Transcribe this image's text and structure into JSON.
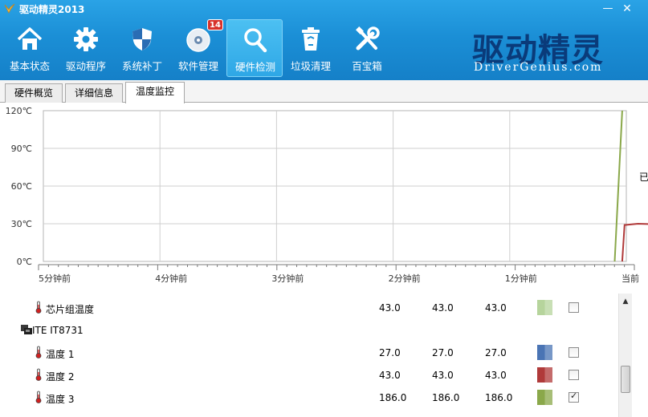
{
  "app": {
    "title": "驱动精灵2013",
    "min": "—",
    "close": "✕"
  },
  "toolbar": {
    "items": [
      {
        "label": "基本状态",
        "icon": "home-icon"
      },
      {
        "label": "驱动程序",
        "icon": "gear-icon"
      },
      {
        "label": "系统补丁",
        "icon": "shield-icon"
      },
      {
        "label": "软件管理",
        "icon": "disc-icon"
      },
      {
        "label": "硬件检测",
        "icon": "magnifier-icon"
      },
      {
        "label": "垃圾清理",
        "icon": "recycle-bin-icon"
      },
      {
        "label": "百宝箱",
        "icon": "tools-icon"
      }
    ],
    "active_index": 4,
    "badge": "14"
  },
  "brand": {
    "cn": "驱动精灵",
    "en": "DriverGenius.com"
  },
  "tabs": [
    {
      "label": "硬件概览"
    },
    {
      "label": "详细信息"
    },
    {
      "label": "温度监控"
    }
  ],
  "active_tab": 2,
  "chart_data": {
    "type": "line",
    "yticks": [
      "120℃",
      "90℃",
      "60℃",
      "30℃",
      "0℃"
    ],
    "ylim": [
      0,
      120
    ],
    "xticks": [
      "5分钟前",
      "4分钟前",
      "3分钟前",
      "2分钟前",
      "1分钟前",
      "当前"
    ],
    "grid": true,
    "series": [
      {
        "color": "#8aa84a",
        "points": [
          [
            0.98,
            0
          ],
          [
            0.993,
            120
          ]
        ]
      },
      {
        "color": "#b03a3a",
        "points": [
          [
            0.993,
            0
          ],
          [
            0.997,
            29
          ],
          [
            1.02,
            30
          ],
          [
            1.09,
            29
          ]
        ]
      }
    ]
  },
  "sensors": [
    {
      "name": "芯片组温度",
      "type": "sensor",
      "v1": "43.0",
      "v2": "43.0",
      "v3": "43.0",
      "color": "#b6d49c",
      "checked": false
    },
    {
      "name": "ITE IT8731",
      "type": "group"
    },
    {
      "name": "温度 1",
      "type": "sensor",
      "v1": "27.0",
      "v2": "27.0",
      "v3": "27.0",
      "color": "#4a74b4",
      "checked": false
    },
    {
      "name": "温度 2",
      "type": "sensor",
      "v1": "43.0",
      "v2": "43.0",
      "v3": "43.0",
      "color": "#b03a3a",
      "checked": false
    },
    {
      "name": "温度 3",
      "type": "sensor",
      "v1": "186.0",
      "v2": "186.0",
      "v3": "186.0",
      "color": "#8aa84a",
      "checked": true
    }
  ],
  "scroll": {
    "up": "▲"
  },
  "edge_text": "已"
}
